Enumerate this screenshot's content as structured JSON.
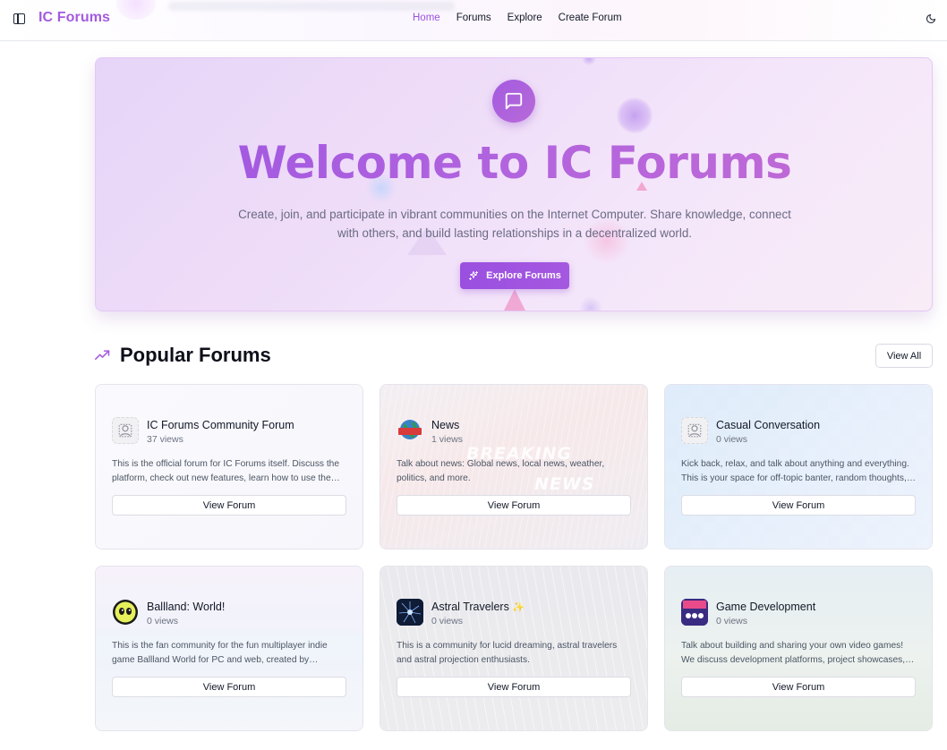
{
  "header": {
    "brand": "IC Forums",
    "nav": [
      {
        "label": "Home",
        "active": true
      },
      {
        "label": "Forums",
        "active": false
      },
      {
        "label": "Explore",
        "active": false
      },
      {
        "label": "Create Forum",
        "active": false
      }
    ],
    "sidebar_toggle_icon": "sidebar-icon",
    "theme_toggle_icon": "moon-icon"
  },
  "hero": {
    "icon": "message-square-icon",
    "title": "Welcome to IC Forums",
    "subtitle": "Create, join, and participate in vibrant communities on the Internet Computer. Share knowledge, connect with others, and build lasting relationships in a decentralized world.",
    "button_label": "Explore Forums",
    "button_icon": "sparkles-icon"
  },
  "popular": {
    "icon": "trending-up-icon",
    "title": "Popular Forums",
    "view_all_label": "View All",
    "forums": [
      {
        "name": "IC Forums Community Forum",
        "views": "37 views",
        "description": "This is the official forum for IC Forums itself. Discuss the platform, check out new features, learn how to use the platform, and more.",
        "button_label": "View Forum",
        "avatar_icon": "forum-logo-icon"
      },
      {
        "name": "News",
        "views": "1 views",
        "description": "Talk about news: Global news, local news, weather, politics, and more.",
        "button_label": "View Forum",
        "avatar_icon": "news-globe-icon"
      },
      {
        "name": "Casual Conversation",
        "views": "0 views",
        "description": "Kick back, relax, and talk about anything and everything. This is your space for off-topic banter, random thoughts, and casual chat.",
        "button_label": "View Forum",
        "avatar_icon": "forum-logo-icon"
      },
      {
        "name": "Ballland: World!",
        "views": "0 views",
        "description": "This is the fan community for the fun multiplayer indie game Ballland World for PC and web, created by ATHENA.",
        "button_label": "View Forum",
        "avatar_icon": "ball-face-icon"
      },
      {
        "name": "Astral Travelers",
        "views": "0 views",
        "description": "This is a community for lucid dreaming, astral travelers and astral projection enthusiasts.",
        "button_label": "View Forum",
        "avatar_icon": "astral-icon",
        "name_suffix": "✨"
      },
      {
        "name": "Game Development",
        "views": "0 views",
        "description": "Talk about building and sharing your own video games! We discuss development platforms, project showcases, and more.",
        "button_label": "View Forum",
        "avatar_icon": "gamepad-icon"
      }
    ]
  },
  "card_decor": {
    "news_line1": "BREAKING",
    "news_line2": "NEWS"
  },
  "colors": {
    "brand": "#a35be0",
    "nav_active": "#9b51e0",
    "button": "#9a4fe0"
  }
}
